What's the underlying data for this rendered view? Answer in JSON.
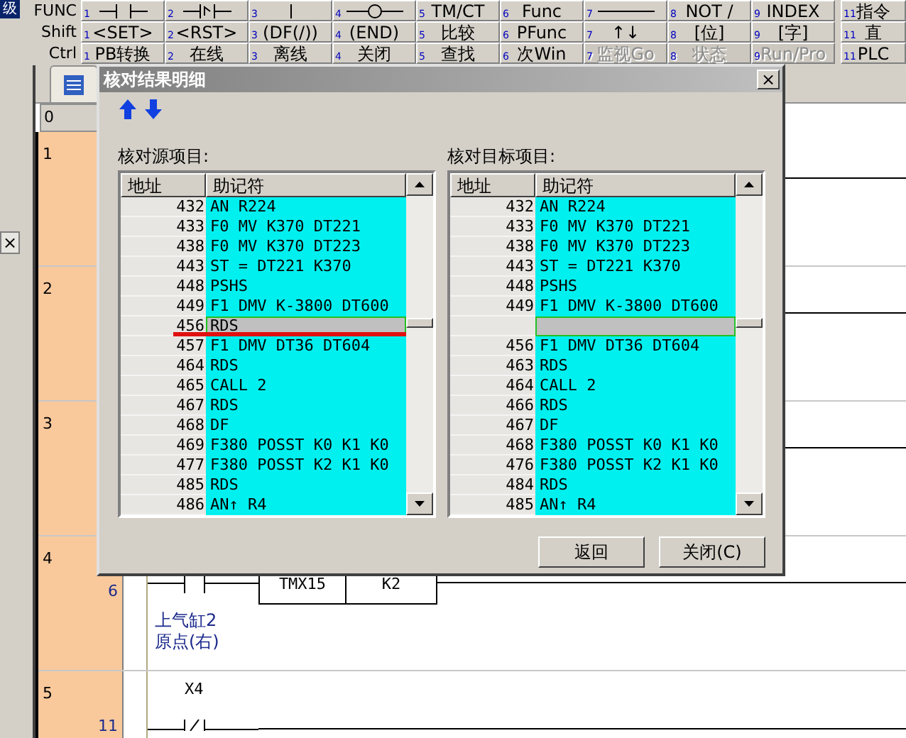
{
  "corner_label": "级",
  "toolbar": {
    "rows": [
      {
        "label": "FUNC",
        "keys": [
          {
            "number": "1",
            "kind": "contact",
            "disabled": false
          },
          {
            "number": "2",
            "kind": "pulse-contact",
            "disabled": false
          },
          {
            "number": "3",
            "kind": "bar",
            "disabled": false
          },
          {
            "number": "4",
            "kind": "coil",
            "disabled": false
          },
          {
            "number": "5",
            "kind": "text",
            "label": "TM/CT",
            "disabled": false
          },
          {
            "number": "6",
            "kind": "text",
            "label": "Func",
            "disabled": false
          },
          {
            "number": "7",
            "kind": "line",
            "disabled": false
          },
          {
            "number": "8",
            "kind": "text",
            "label": "NOT /",
            "disabled": false
          },
          {
            "number": "9",
            "kind": "text",
            "label": "INDEX",
            "disabled": false
          },
          {
            "number": "11",
            "kind": "text",
            "label": "指令",
            "disabled": false
          }
        ]
      },
      {
        "label": "Shift",
        "keys": [
          {
            "number": "1",
            "kind": "text",
            "label": "<SET>",
            "disabled": false
          },
          {
            "number": "2",
            "kind": "text",
            "label": "<RST>",
            "disabled": false
          },
          {
            "number": "3",
            "kind": "text",
            "label": "(DF(/))",
            "disabled": false
          },
          {
            "number": "4",
            "kind": "text",
            "label": "(END)",
            "disabled": false
          },
          {
            "number": "5",
            "kind": "text",
            "label": "比较",
            "disabled": false
          },
          {
            "number": "6",
            "kind": "text",
            "label": "PFunc",
            "disabled": false
          },
          {
            "number": "7",
            "kind": "text",
            "label": "↑↓",
            "disabled": false
          },
          {
            "number": "8",
            "kind": "text",
            "label": "[位]",
            "disabled": false
          },
          {
            "number": "9",
            "kind": "text",
            "label": "[字]",
            "disabled": false
          },
          {
            "number": "11",
            "kind": "text",
            "label": "直",
            "disabled": false
          }
        ]
      },
      {
        "label": "Ctrl",
        "keys": [
          {
            "number": "1",
            "kind": "text",
            "label": "PB转换",
            "disabled": false
          },
          {
            "number": "2",
            "kind": "text",
            "label": "在线",
            "disabled": false
          },
          {
            "number": "3",
            "kind": "text",
            "label": "离线",
            "disabled": false
          },
          {
            "number": "4",
            "kind": "text",
            "label": "关闭",
            "disabled": false
          },
          {
            "number": "5",
            "kind": "text",
            "label": "查找",
            "disabled": false
          },
          {
            "number": "6",
            "kind": "text",
            "label": "次Win",
            "disabled": false
          },
          {
            "number": "7",
            "kind": "text",
            "label": "监视Go",
            "disabled": true
          },
          {
            "number": "8",
            "kind": "text",
            "label": "状态",
            "disabled": true
          },
          {
            "number": "9",
            "kind": "text",
            "label": "Run/Pro",
            "disabled": true
          },
          {
            "number": "11",
            "kind": "text",
            "label": "PLC",
            "disabled": false
          }
        ]
      }
    ]
  },
  "side_panel": {
    "close": "×"
  },
  "ladder": {
    "header": "0",
    "rows": [
      {
        "number": "1",
        "kind": "rail"
      },
      {
        "number": "2",
        "kind": "rail"
      },
      {
        "number": "3",
        "kind": "rail"
      },
      {
        "number": "4",
        "kind": "timer",
        "step": "6",
        "timer": "TMX15",
        "preset": "K2",
        "comment": [
          "上气缸2",
          "原点(右)"
        ]
      },
      {
        "number": "5",
        "kind": "contact",
        "step": "11",
        "contact": "X4"
      }
    ]
  },
  "dialog": {
    "title": "核对结果明细",
    "close": "×",
    "lists": [
      {
        "label": "核对源项目:",
        "columns": [
          "地址",
          "助记符"
        ],
        "rows": [
          {
            "address": "432",
            "mnemonic": "AN R224",
            "differs": false
          },
          {
            "address": "433",
            "mnemonic": "F0 MV K370 DT221",
            "differs": false
          },
          {
            "address": "438",
            "mnemonic": "F0 MV K370 DT223",
            "differs": false
          },
          {
            "address": "443",
            "mnemonic": "ST = DT221 K370",
            "differs": false
          },
          {
            "address": "448",
            "mnemonic": "PSHS",
            "differs": false
          },
          {
            "address": "449",
            "mnemonic": "F1 DMV K-3800 DT600",
            "differs": false
          },
          {
            "address": "456",
            "mnemonic": "RDS",
            "differs": true
          },
          {
            "address": "457",
            "mnemonic": "F1 DMV DT36 DT604",
            "differs": false
          },
          {
            "address": "464",
            "mnemonic": "RDS",
            "differs": false
          },
          {
            "address": "465",
            "mnemonic": "CALL 2",
            "differs": false
          },
          {
            "address": "467",
            "mnemonic": "RDS",
            "differs": false
          },
          {
            "address": "468",
            "mnemonic": "DF",
            "differs": false
          },
          {
            "address": "469",
            "mnemonic": "F380 POSST K0 K1 K0",
            "differs": false
          },
          {
            "address": "477",
            "mnemonic": "F380 POSST K2 K1 K0",
            "differs": false
          },
          {
            "address": "485",
            "mnemonic": "RDS",
            "differs": false
          },
          {
            "address": "486",
            "mnemonic": "AN↑ R4",
            "differs": false
          }
        ]
      },
      {
        "label": "核对目标项目:",
        "columns": [
          "地址",
          "助记符"
        ],
        "rows": [
          {
            "address": "432",
            "mnemonic": "AN R224",
            "differs": false
          },
          {
            "address": "433",
            "mnemonic": "F0 MV K370 DT221",
            "differs": false
          },
          {
            "address": "438",
            "mnemonic": "F0 MV K370 DT223",
            "differs": false
          },
          {
            "address": "443",
            "mnemonic": "ST = DT221 K370",
            "differs": false
          },
          {
            "address": "448",
            "mnemonic": "PSHS",
            "differs": false
          },
          {
            "address": "449",
            "mnemonic": "F1 DMV K-3800 DT600",
            "differs": false
          },
          {
            "differs": true
          },
          {
            "address": "456",
            "mnemonic": "F1 DMV DT36 DT604",
            "differs": false
          },
          {
            "address": "463",
            "mnemonic": "RDS",
            "differs": false
          },
          {
            "address": "464",
            "mnemonic": "CALL 2",
            "differs": false
          },
          {
            "address": "466",
            "mnemonic": "RDS",
            "differs": false
          },
          {
            "address": "467",
            "mnemonic": "DF",
            "differs": false
          },
          {
            "address": "468",
            "mnemonic": "F380 POSST K0 K1 K0",
            "differs": false
          },
          {
            "address": "476",
            "mnemonic": "F380 POSST K2 K1 K0",
            "differs": false
          },
          {
            "address": "484",
            "mnemonic": "RDS",
            "differs": false
          },
          {
            "address": "485",
            "mnemonic": "AN↑ R4",
            "differs": false
          }
        ]
      }
    ],
    "buttons": [
      {
        "label": "返回"
      },
      {
        "label": "关闭(C)"
      }
    ]
  }
}
